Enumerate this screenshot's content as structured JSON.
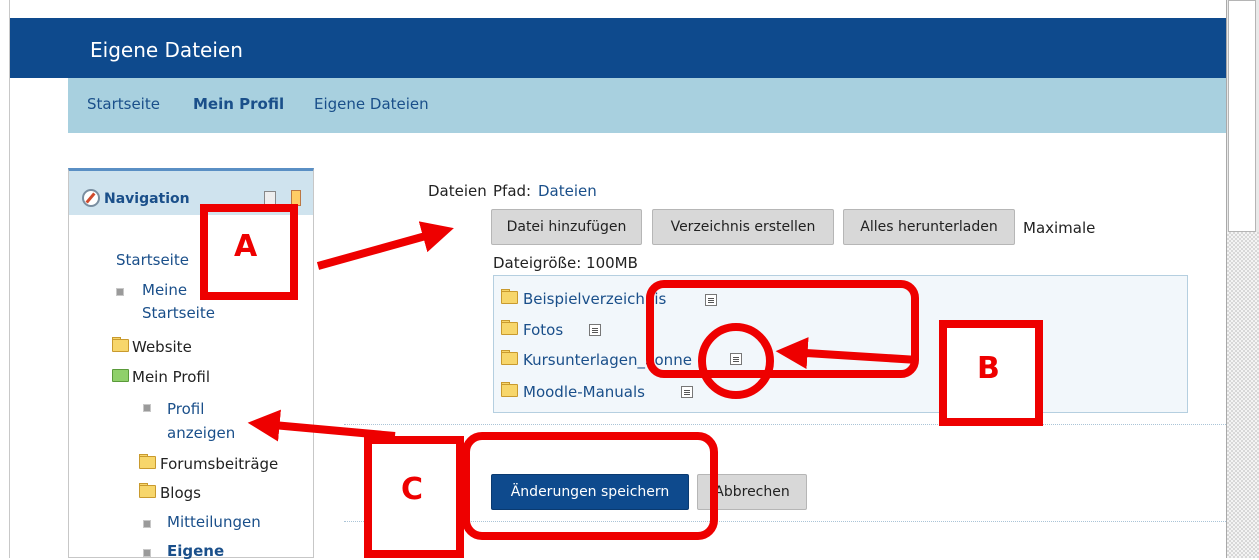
{
  "header": {
    "title": "Eigene Dateien"
  },
  "breadcrumb": {
    "home": "Startseite",
    "profile": "Mein Profil",
    "files": "Eigene Dateien"
  },
  "navigation": {
    "title": "Navigation",
    "items": {
      "startseite": "Startseite",
      "meine_startseite": "Meine Startseite",
      "website": "Website",
      "mein_profil": "Mein Profil",
      "profil_anzeigen": "Profil anzeigen",
      "forumsbeitraege": "Forumsbeiträge",
      "blogs": "Blogs",
      "mitteilungen": "Mitteilungen",
      "eigene": "Eigene"
    }
  },
  "files": {
    "label": "Dateien",
    "path_label": "Pfad:",
    "path_link": "Dateien",
    "add_file": "Datei hinzufügen",
    "create_dir": "Verzeichnis erstellen",
    "download_all": "Alles herunterladen",
    "max_label_1": "Maximale",
    "max_label_2": "Dateigröße: 100MB",
    "tree": [
      {
        "name": "Beispielverzeichnis"
      },
      {
        "name": "Fotos"
      },
      {
        "name": "Kursunterlagen_Sonne"
      },
      {
        "name": "Moodle-Manuals"
      }
    ]
  },
  "actions": {
    "save": "Änderungen speichern",
    "cancel": "Abbrechen"
  },
  "annotations": {
    "a": "A",
    "b": "B",
    "c": "C"
  },
  "colors": {
    "header": "#0e4a8d",
    "navbar": "#a8d0df",
    "annotation": "#ee0000",
    "link": "#1a4f8a"
  }
}
